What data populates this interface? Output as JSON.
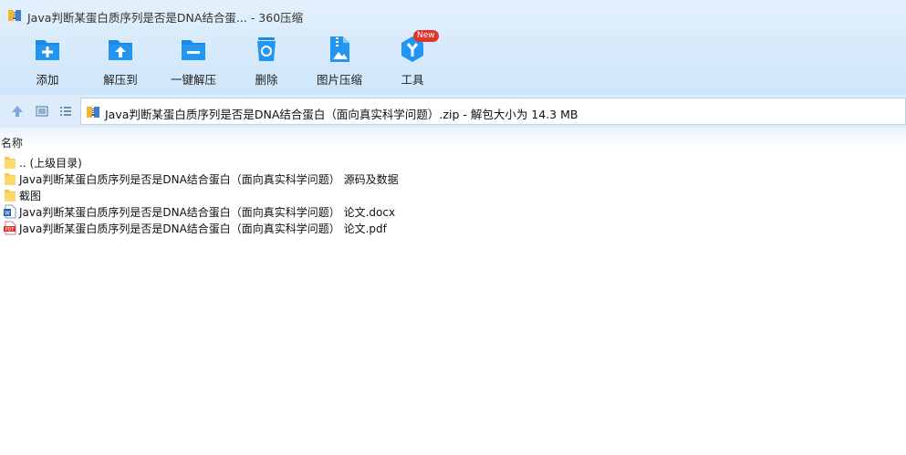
{
  "window": {
    "title": "Java判断某蛋白质序列是否是DNA结合蛋... - 360压缩"
  },
  "toolbar": {
    "items": [
      {
        "label": "添加",
        "icon": "add-icon"
      },
      {
        "label": "解压到",
        "icon": "extract-to-icon"
      },
      {
        "label": "一键解压",
        "icon": "one-click-extract-icon"
      },
      {
        "label": "删除",
        "icon": "delete-icon"
      },
      {
        "label": "图片压缩",
        "icon": "image-compress-icon"
      },
      {
        "label": "工具",
        "icon": "tools-icon"
      }
    ],
    "badge": "New"
  },
  "address": {
    "text": "Java判断某蛋白质序列是否是DNA结合蛋白（面向真实科学问题）.zip - 解包大小为 14.3 MB"
  },
  "list": {
    "header": "名称",
    "rows": [
      {
        "name": ".. (上级目录)",
        "icon": "folder-icon"
      },
      {
        "name": "Java判断某蛋白质序列是否是DNA结合蛋白（面向真实科学问题） 源码及数据",
        "icon": "folder-icon"
      },
      {
        "name": "截图",
        "icon": "folder-icon"
      },
      {
        "name": "Java判断某蛋白质序列是否是DNA结合蛋白（面向真实科学问题） 论文.docx",
        "icon": "word-doc-icon"
      },
      {
        "name": "Java判断某蛋白质序列是否是DNA结合蛋白（面向真实科学问题） 论文.pdf",
        "icon": "pdf-icon"
      }
    ]
  },
  "colors": {
    "accent": "#1e88e5",
    "toolbar_bg": "#d9ebfb",
    "new_badge": "#e0352b"
  }
}
